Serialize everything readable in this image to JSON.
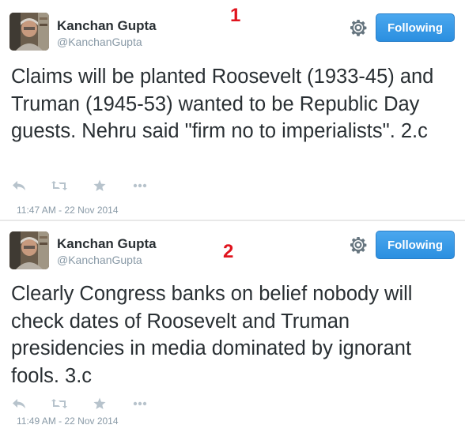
{
  "tweets": [
    {
      "name": "Kanchan Gupta",
      "handle": "@KanchanGupta",
      "annotation": "1",
      "follow_label": "Following",
      "text": "Claims will be planted Roosevelt (1933-45) and Truman (1945-53) wanted to be Republic Day guests. Nehru said \"firm no to imperialists\". 2.c",
      "timestamp": "11:47 AM - 22 Nov 2014",
      "icons": [
        "reply-icon",
        "retweet-icon",
        "favorite-icon",
        "more-icon",
        "gear-icon"
      ]
    },
    {
      "name": "Kanchan Gupta",
      "handle": "@KanchanGupta",
      "annotation": "2",
      "follow_label": "Following",
      "text": "Clearly Congress banks on belief nobody will check dates of Roosevelt and Truman presidencies in media dominated by ignorant fools. 3.c",
      "timestamp": "11:49 AM - 22 Nov 2014",
      "icons": [
        "reply-icon",
        "retweet-icon",
        "favorite-icon",
        "more-icon",
        "gear-icon"
      ]
    }
  ],
  "colors": {
    "follow_button": "#3a9be8",
    "annotation": "#e0141e",
    "muted": "#8899a6",
    "text": "#292f33"
  }
}
